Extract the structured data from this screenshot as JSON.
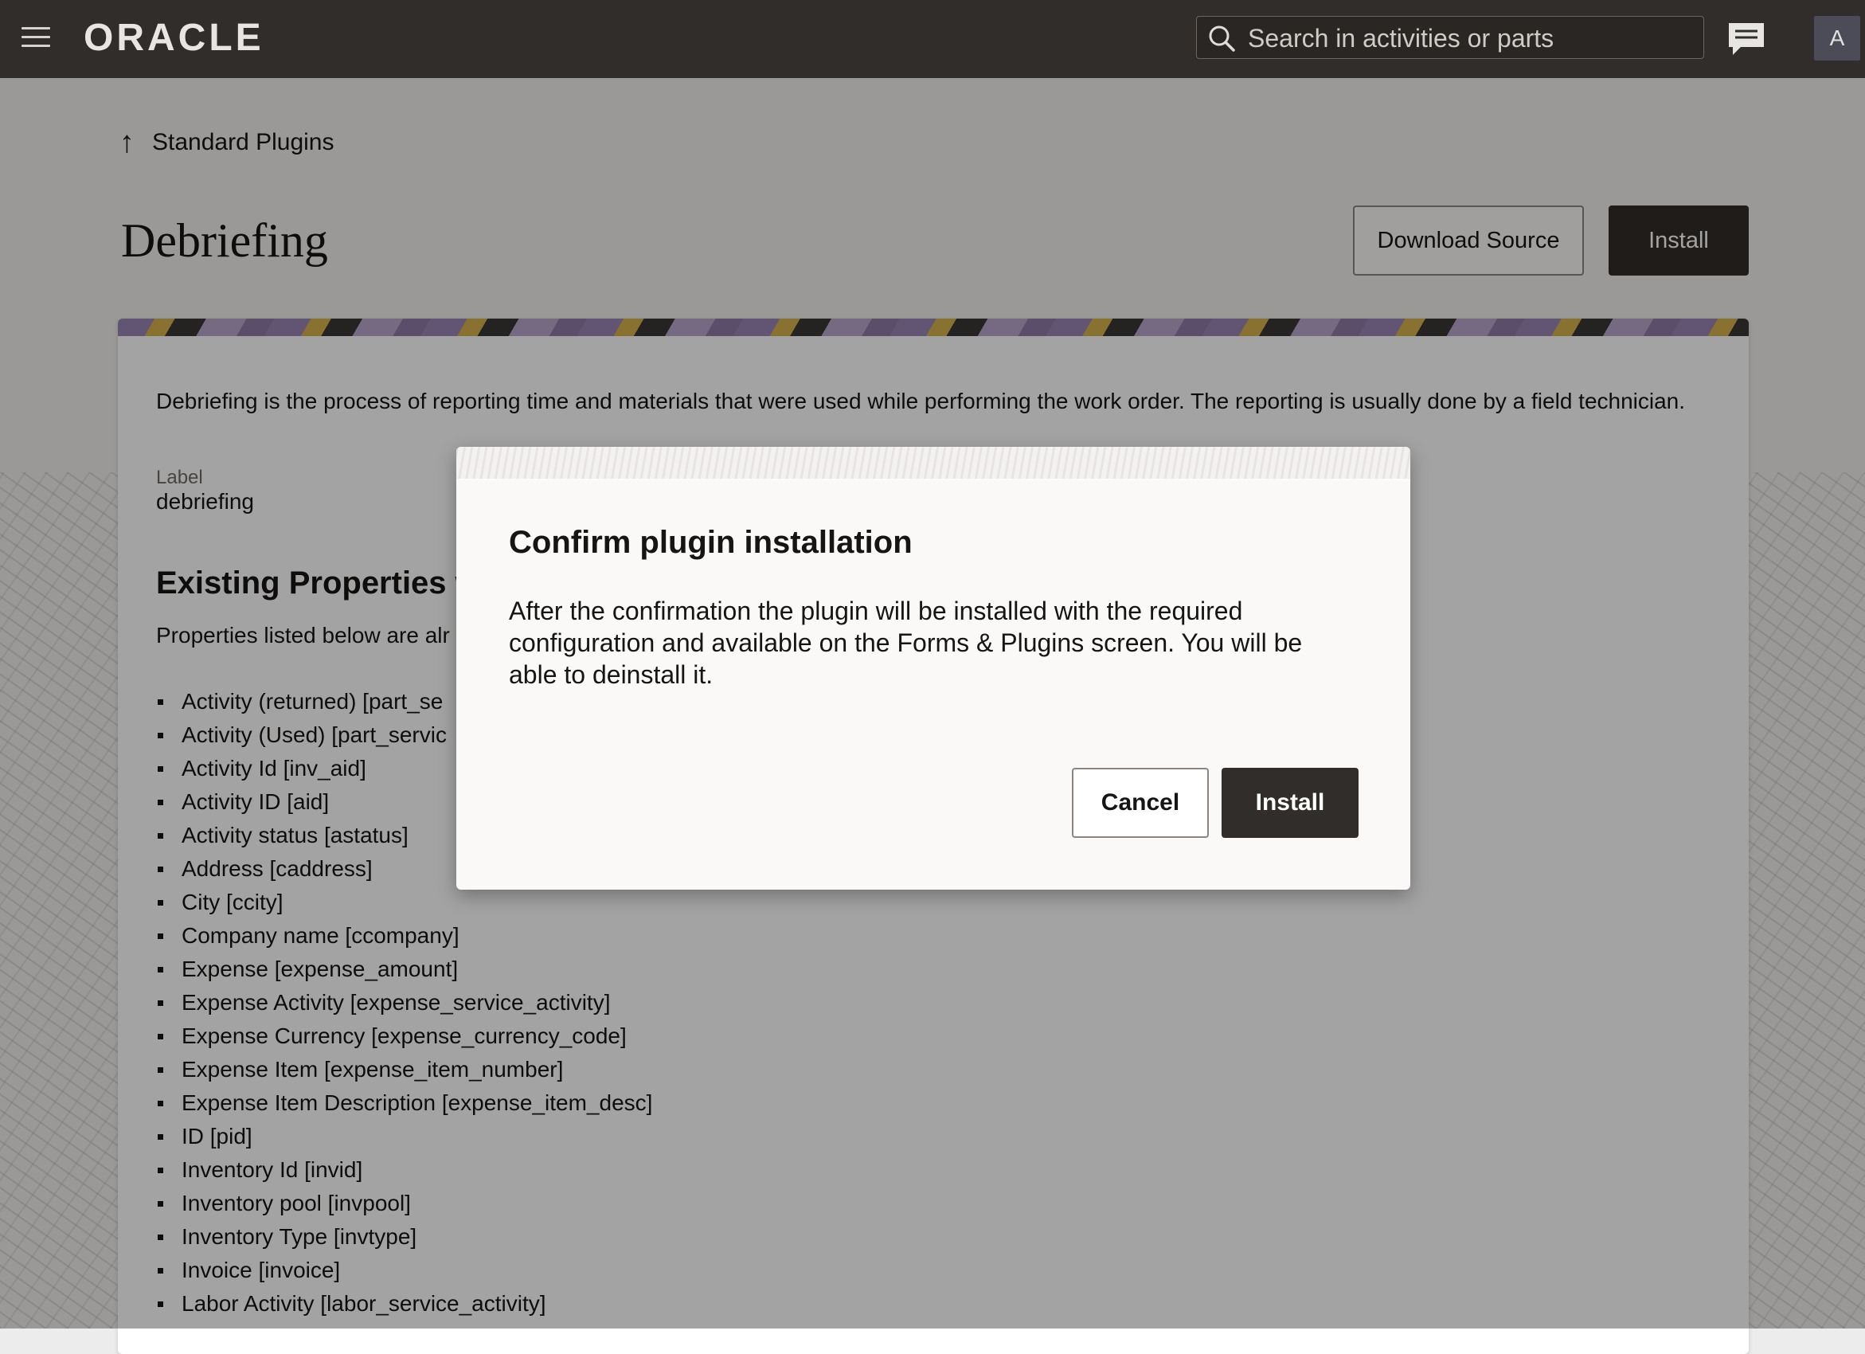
{
  "header": {
    "logo": "ORACLE",
    "search_placeholder": "Search in activities or parts",
    "avatar_initial": "A",
    "icons": [
      "hamburger-menu-icon",
      "search-icon",
      "chat-icon"
    ]
  },
  "page": {
    "back_label": "Standard Plugins",
    "title": "Debriefing",
    "download_label": "Download Source",
    "install_label": "Install",
    "description": "Debriefing is the process of reporting time and materials that were used while performing the work order. The reporting is usually done by a field technician.",
    "label_caption": "Label",
    "label_value": "debriefing",
    "section_title": "Existing Properties w",
    "section_desc": "Properties listed below are alr",
    "properties": [
      "Activity (returned) [part_se",
      "Activity (Used) [part_servic",
      "Activity Id [inv_aid]",
      "Activity ID [aid]",
      "Activity status [astatus]",
      "Address [caddress]",
      "City [ccity]",
      "Company name [ccompany]",
      "Expense [expense_amount]",
      "Expense Activity [expense_service_activity]",
      "Expense Currency [expense_currency_code]",
      "Expense Item [expense_item_number]",
      "Expense Item Description [expense_item_desc]",
      "ID [pid]",
      "Inventory Id [invid]",
      "Inventory pool [invpool]",
      "Inventory Type [invtype]",
      "Invoice [invoice]",
      "Labor Activity [labor_service_activity]"
    ]
  },
  "dialog": {
    "title": "Confirm plugin installation",
    "message": "After the confirmation the plugin will be installed with the required configuration and available on the Forms & Plugins screen. You will be able to deinstall it.",
    "cancel_label": "Cancel",
    "install_label": "Install"
  },
  "colors": {
    "header_bg": "#312d2a",
    "primary_button": "#312d2a",
    "overlay": "rgba(0,0,0,0.36)"
  }
}
